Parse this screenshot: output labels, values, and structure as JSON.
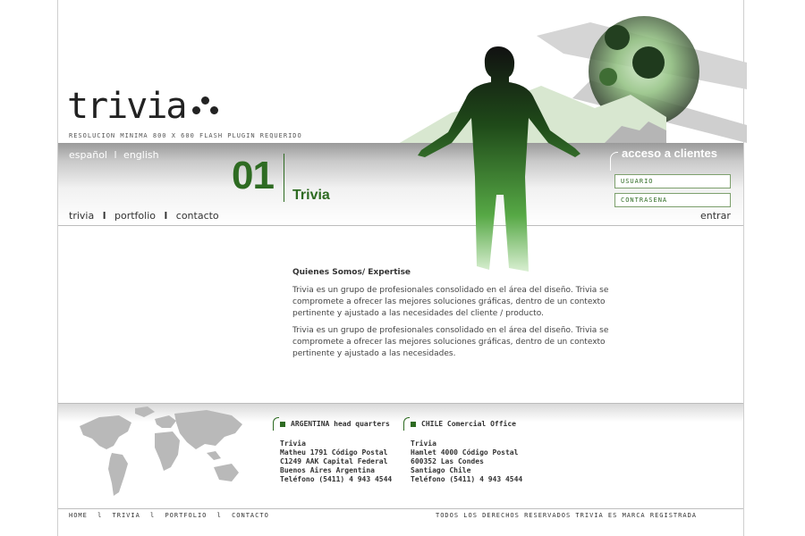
{
  "header": {
    "logo_text": "trivia",
    "tagline": "RESOLUCION MINIMA 800 X 600 FLASH PLUGIN REQUERIDO"
  },
  "lang": {
    "es": "español",
    "sep": "l",
    "en": "english"
  },
  "section": {
    "number": "01",
    "title": "Trivia"
  },
  "nav": {
    "items": [
      "trivia",
      "portfolio",
      "contacto"
    ],
    "sep": "l"
  },
  "clients": {
    "title": "acceso a clientes",
    "user_placeholder": "USUARIO",
    "pass_placeholder": "CONTRASEÑA",
    "enter": "entrar"
  },
  "content": {
    "heading": "Quienes Somos/ Expertise",
    "p1": "Trivia es un grupo de profesionales consolidado en el área del diseño. Trivia se compromete a ofrecer las mejores soluciones gráficas, dentro de un contexto pertinente y ajustado a las necesidades del cliente / producto.",
    "p2": "Trivia es un grupo de profesionales consolidado en el área del diseño. Trivia se compromete a ofrecer las mejores soluciones gráficas, dentro de un contexto pertinente y ajustado a las necesidades."
  },
  "offices": [
    {
      "title": "ARGENTINA head quarters",
      "lines": [
        "Trivia",
        "Matheu 1791 Código Postal",
        "C1249 AAK Capital Federal",
        "Buenos Aires Argentina",
        "Teléfono (5411) 4 943 4544"
      ]
    },
    {
      "title": "CHILE Comercial Office",
      "lines": [
        "Trivia",
        "Hamlet 4000 Código Postal",
        "600352 Las Condes",
        "Santiago Chile",
        "Teléfono (5411) 4 943 4544"
      ]
    }
  ],
  "footer": {
    "nav": [
      "HOME",
      "TRIVIA",
      "PORTFOLIO",
      "CONTACTO"
    ],
    "sep": "l",
    "rights": "TODOS LOS DERECHOS RESERVADOS  TRIVIA ES MARCA REGISTRADA"
  },
  "colors": {
    "accent": "#2e6b22",
    "band": "#9a9a9a"
  },
  "icons": [
    "world-map",
    "person-silhouette",
    "sphere-graphic"
  ]
}
